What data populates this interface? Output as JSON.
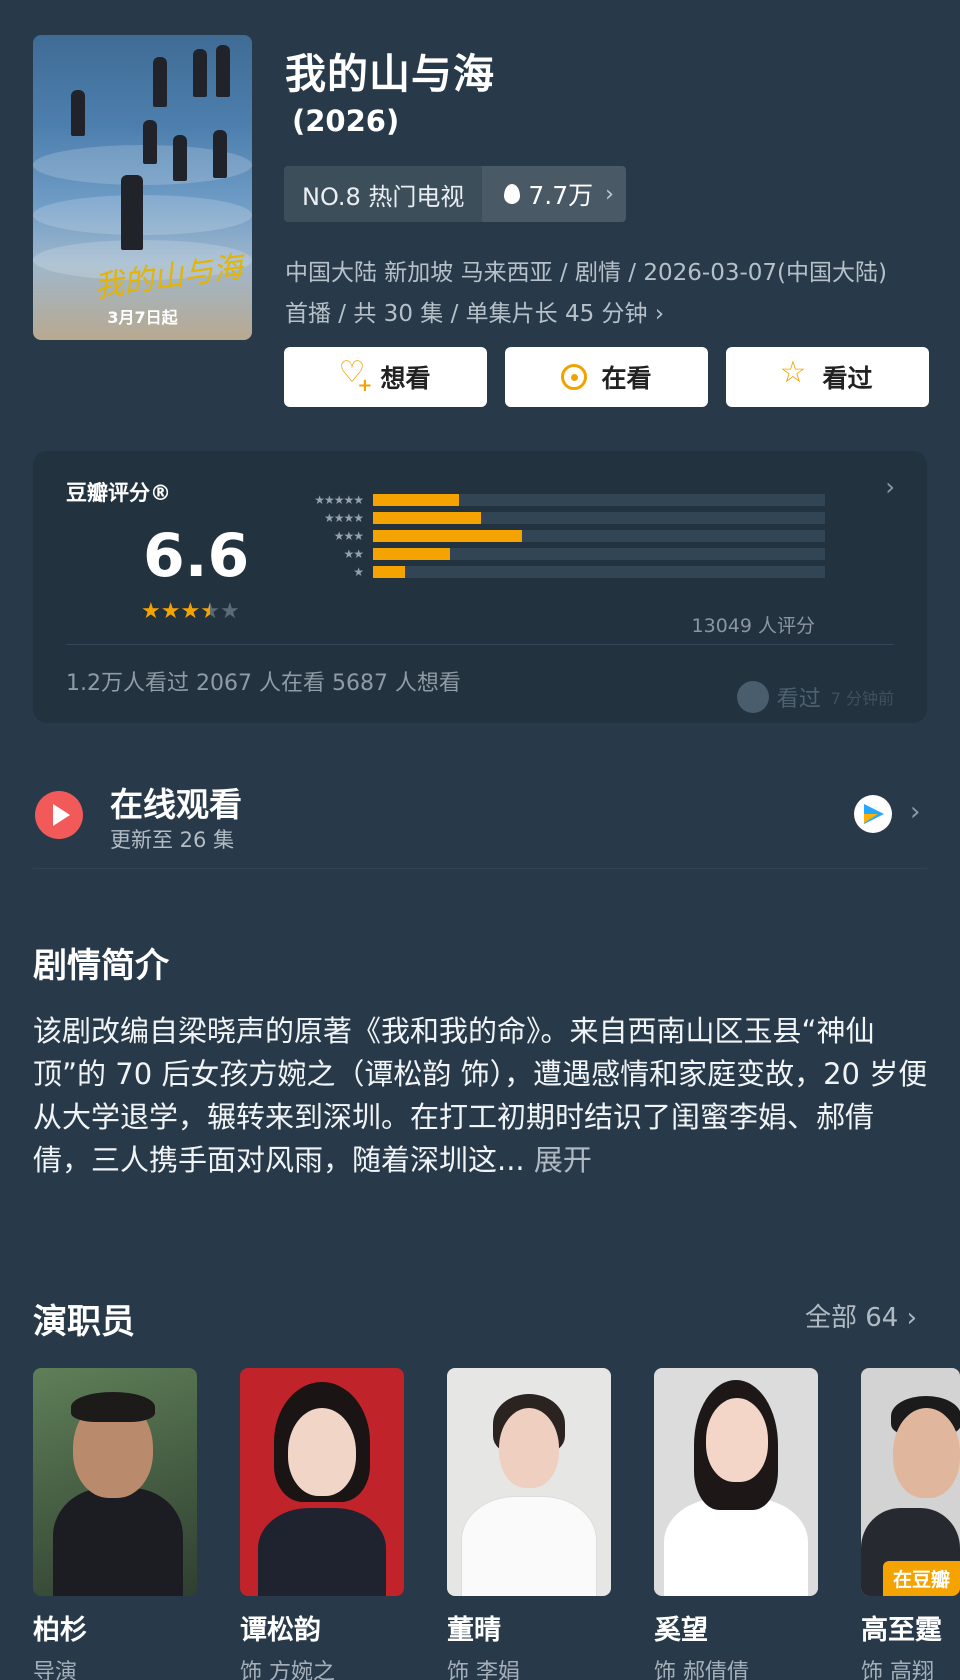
{
  "header": {
    "title": "我的山与海",
    "year": "(2026)",
    "poster_caption": "3月7日起",
    "poster_logo": "我的山与海",
    "rank_label": "NO.8 热门电视",
    "heat": "7.7万",
    "meta_line1": "中国大陆 新加坡 马来西亚 / 剧情 / 2026-03-07(中国大陆)",
    "meta_line2": "首播 / 共 30 集 / 单集片长 45 分钟",
    "actions": {
      "want": "想看",
      "watching": "在看",
      "watched": "看过"
    }
  },
  "rating": {
    "label": "豆瓣评分®",
    "score": "6.6",
    "stars": 3.5,
    "distribution": [
      {
        "stars": "★★★★★",
        "fraction": 0.19
      },
      {
        "stars": "★★★★",
        "fraction": 0.24
      },
      {
        "stars": "★★★",
        "fraction": 0.33
      },
      {
        "stars": "★★",
        "fraction": 0.17
      },
      {
        "stars": "★",
        "fraction": 0.07
      }
    ],
    "count": "13049 人评分",
    "stats": "1.2万人看过   2067 人在看   5687 人想看",
    "seen_label": "看过",
    "seen_time": "7 分钟前"
  },
  "online": {
    "title": "在线观看",
    "subtitle": "更新至 26 集"
  },
  "synopsis": {
    "title": "剧情简介",
    "text": "该剧改编自梁晓声的原著《我和我的命》。来自西南山区玉县“神仙顶”的 70 后女孩方婉之（谭松韵 饰），遭遇感情和家庭变故，20 岁便从大学退学，辗转来到深圳。在打工初期时结识了闺蜜李娟、郝倩倩，三人携手面对风雨，随着深圳这...",
    "more": "展开"
  },
  "cast": {
    "title": "演职员",
    "all_label": "全部 64",
    "people": [
      {
        "name": "柏杉",
        "role": "导演"
      },
      {
        "name": "谭松韵",
        "role": "饰 方婉之"
      },
      {
        "name": "董晴",
        "role": "饰 李娟"
      },
      {
        "name": "奚望",
        "role": "饰 郝倩倩"
      },
      {
        "name": "高至霆",
        "role": "饰 高翔",
        "badge": "在豆瓣"
      }
    ]
  },
  "colors": {
    "background": "#283a49",
    "accent": "#f5a300",
    "card": "#22323f",
    "play": "#f25a5a"
  }
}
